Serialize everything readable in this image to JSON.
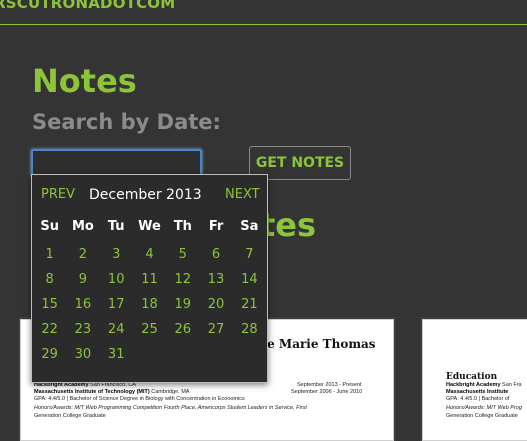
{
  "header": {
    "site_name": "RSCUTRONADOTCOM"
  },
  "main": {
    "title": "Notes",
    "search_label": "Search by Date:",
    "date_input_value": "",
    "get_notes_label": "GET NOTES",
    "notes_heading_partial": "otes"
  },
  "calendar": {
    "prev_label": "PREV",
    "next_label": "NEXT",
    "month_year": "December 2013",
    "weekdays": [
      "Su",
      "Mo",
      "Tu",
      "We",
      "Th",
      "Fr",
      "Sa"
    ],
    "weeks": [
      [
        "1",
        "2",
        "3",
        "4",
        "5",
        "6",
        "7"
      ],
      [
        "8",
        "9",
        "10",
        "11",
        "12",
        "13",
        "14"
      ],
      [
        "15",
        "16",
        "17",
        "18",
        "19",
        "20",
        "21"
      ],
      [
        "22",
        "23",
        "24",
        "25",
        "26",
        "27",
        "28"
      ],
      [
        "29",
        "30",
        "31",
        "",
        "",
        "",
        ""
      ]
    ]
  },
  "documents": [
    {
      "name_partial": "tie Marie Thomas",
      "lines": [
        {
          "bold": "Hackbright Academy",
          "text": " San Francisco, CA",
          "right": "September 2013 - Present"
        },
        {
          "bold": "Massachusetts Institute of Technology (MIT)",
          "text": " Cambridge, MA",
          "right": "September 2006 - June 2010"
        },
        {
          "bold": "",
          "text": "GPA: 4.4/5.0  |  Bachelor of Science Degree in Biology with Concentration in Economics",
          "right": ""
        },
        {
          "bold": "",
          "text": "Honors/Awards: MIT Web Programming Competition Fourth Place, Americorps Student Leaders in Service, First",
          "right": ""
        },
        {
          "bold": "",
          "text": "Generation College Graduate",
          "right": ""
        }
      ]
    },
    {
      "edu_title": "Education",
      "lines": [
        {
          "bold": "Hackbright Academy",
          "text": " San Fra",
          "right": ""
        },
        {
          "bold": "Massachusetts Institute",
          "text": "",
          "right": ""
        },
        {
          "bold": "",
          "text": "GPA: 4.4/5.0  |  Bachelor of",
          "right": ""
        },
        {
          "bold": "",
          "text": "Honors/Awards: MIT Web Prog",
          "right": ""
        },
        {
          "bold": "",
          "text": "Generation College Graduate",
          "right": ""
        }
      ]
    }
  ],
  "colors": {
    "background": "#343434",
    "accent": "#8cc43a",
    "muted_text": "#8b8b8b",
    "input_focus": "#4d86c8"
  }
}
